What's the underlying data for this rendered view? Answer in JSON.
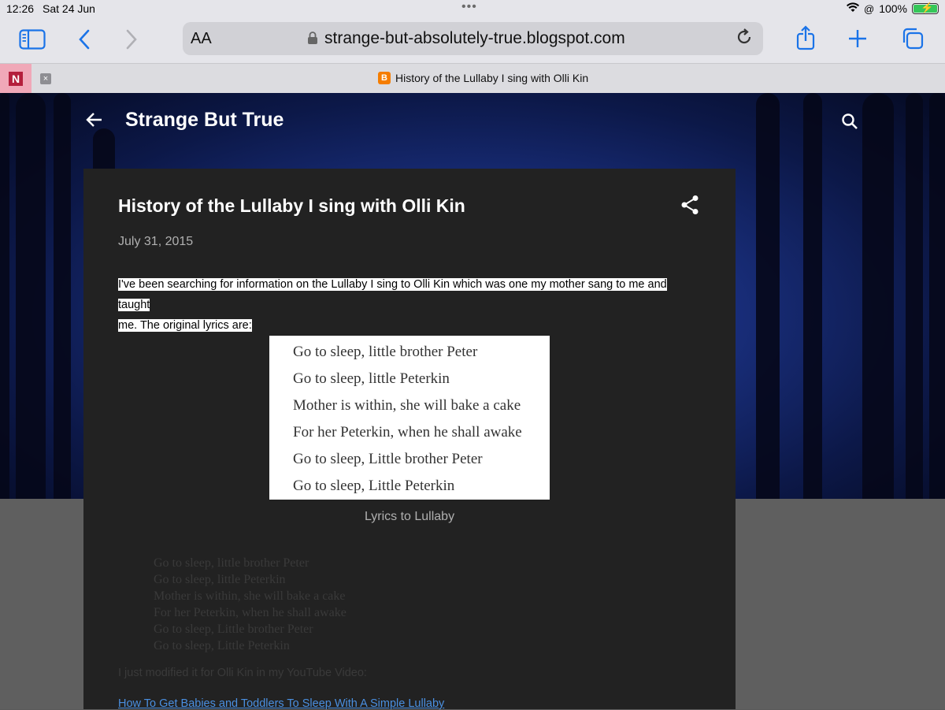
{
  "status": {
    "time": "12:26",
    "date": "Sat 24 Jun",
    "battery": "100%",
    "dots": "•••"
  },
  "toolbar": {
    "sidebar_icon": "sidebar-icon",
    "back_icon": "back-icon",
    "forward_icon": "forward-icon",
    "reader_label": "AA",
    "url": "strange-but-absolutely-true.blogspot.com",
    "reload_icon": "reload-icon",
    "share_icon": "share-icon",
    "new_tab_icon": "plus-icon",
    "tabs_icon": "tabs-icon"
  },
  "tabs": {
    "pinned_label": "N",
    "close_label": "×",
    "active_title": "History of the Lullaby I sing with Olli Kin"
  },
  "blog": {
    "title": "Strange But True"
  },
  "post": {
    "title": "History of the Lullaby I sing with Olli Kin",
    "date": "July 31, 2015",
    "intro_line1": "I've been searching for information on the Lullaby I sing to Olli Kin which was one my mother sang to me and taught",
    "intro_line2": "me.  The original lyrics are:",
    "lyrics": [
      "Go to sleep, little brother Peter",
      "Go to sleep, little Peterkin",
      "Mother is within, she will bake a cake",
      "For her Peterkin, when he shall awake",
      "Go to sleep, Little brother Peter",
      "Go to sleep, Little Peterkin"
    ],
    "caption": "Lyrics to Lullaby",
    "modified_text": "I just modified it for Olli Kin in my YouTube Video:",
    "link_text": "How To Get Babies and Toddlers To Sleep With A Simple Lullaby"
  },
  "colors": {
    "accent": "#1a73e8",
    "link": "#4a8fe0",
    "card": "#222222"
  }
}
